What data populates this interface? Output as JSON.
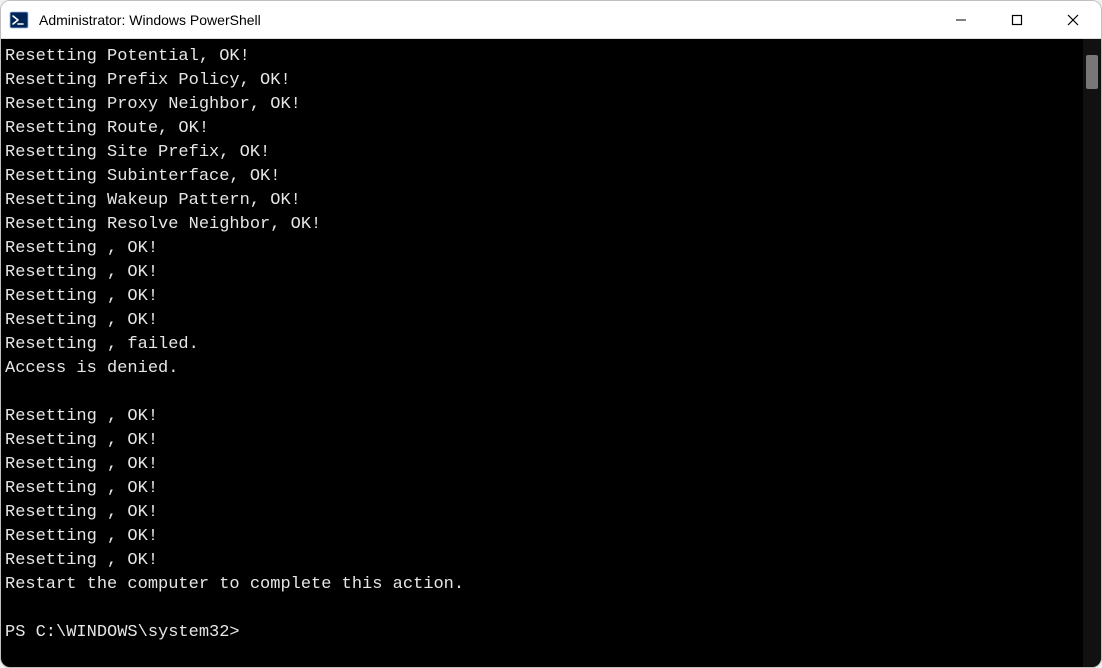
{
  "window": {
    "title": "Administrator: Windows PowerShell"
  },
  "console": {
    "lines": [
      "Resetting Potential, OK!",
      "Resetting Prefix Policy, OK!",
      "Resetting Proxy Neighbor, OK!",
      "Resetting Route, OK!",
      "Resetting Site Prefix, OK!",
      "Resetting Subinterface, OK!",
      "Resetting Wakeup Pattern, OK!",
      "Resetting Resolve Neighbor, OK!",
      "Resetting , OK!",
      "Resetting , OK!",
      "Resetting , OK!",
      "Resetting , OK!",
      "Resetting , failed.",
      "Access is denied.",
      "",
      "Resetting , OK!",
      "Resetting , OK!",
      "Resetting , OK!",
      "Resetting , OK!",
      "Resetting , OK!",
      "Resetting , OK!",
      "Resetting , OK!",
      "Restart the computer to complete this action.",
      ""
    ],
    "prompt": "PS C:\\WINDOWS\\system32>"
  }
}
